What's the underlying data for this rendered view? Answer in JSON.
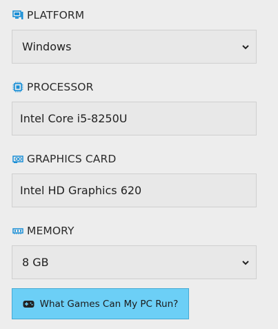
{
  "platform": {
    "label": "PLATFORM",
    "icon": "monitor-icon",
    "value": "Windows"
  },
  "processor": {
    "label": "PROCESSOR",
    "icon": "cpu-chip-icon",
    "value": "Intel Core i5-8250U"
  },
  "graphics": {
    "label": "GRAPHICS CARD",
    "icon": "graphics-card-icon",
    "value": "Intel HD Graphics 620"
  },
  "memory": {
    "label": "MEMORY",
    "icon": "memory-module-icon",
    "value": "8 GB"
  },
  "cta": {
    "label": "What Games Can My PC Run?",
    "icon": "gamepad-icon"
  },
  "colors": {
    "icon_blue": "#1a8fd6",
    "button_bg": "#6ccff6",
    "page_bg": "#ededed"
  }
}
